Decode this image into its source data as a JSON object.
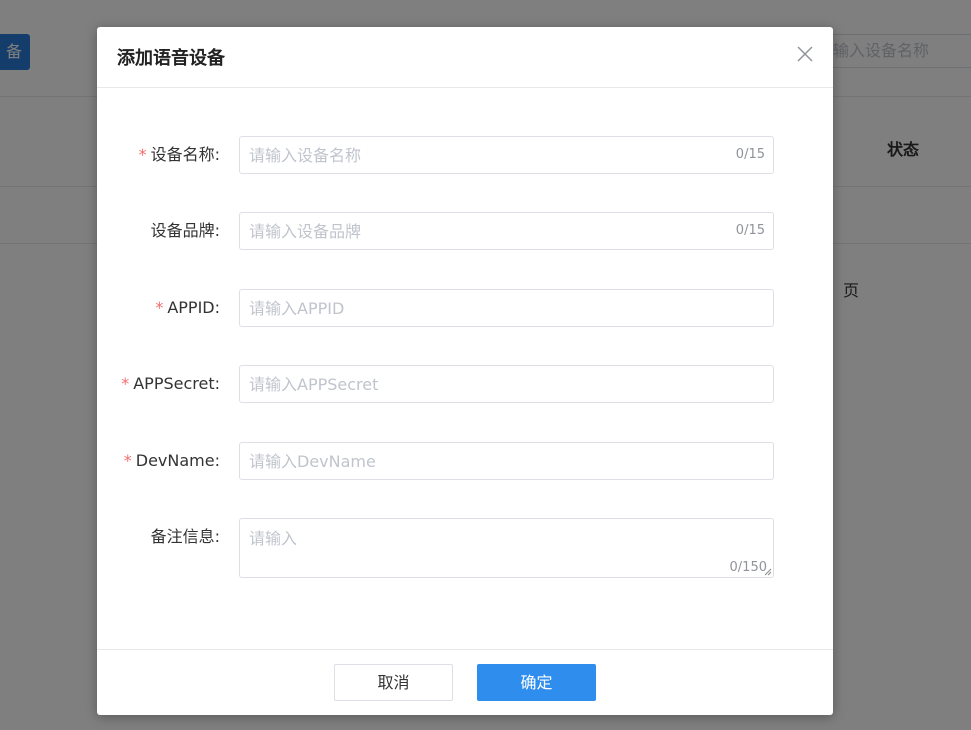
{
  "background": {
    "add_button_partial": "备",
    "search_placeholder_partial": "输入设备名称",
    "table_header_status": "状态",
    "pager_suffix": "页"
  },
  "dialog": {
    "title": "添加语音设备",
    "close_icon": "close-icon",
    "fields": [
      {
        "label": "设备名称:",
        "required": true,
        "placeholder": "请输入设备名称",
        "value": "",
        "counter": "0/15"
      },
      {
        "label": "设备品牌:",
        "required": false,
        "placeholder": "请输入设备品牌",
        "value": "",
        "counter": "0/15"
      },
      {
        "label": "APPID:",
        "required": true,
        "placeholder": "请输入APPID",
        "value": ""
      },
      {
        "label": "APPSecret:",
        "required": true,
        "placeholder": "请输入APPSecret",
        "value": ""
      },
      {
        "label": "DevName:",
        "required": true,
        "placeholder": "请输入DevName",
        "value": ""
      },
      {
        "label": "备注信息:",
        "required": false,
        "placeholder": "请输入",
        "value": "",
        "counter": "0/150"
      }
    ],
    "required_mark": "*",
    "cancel_label": "取消",
    "confirm_label": "确定"
  },
  "colors": {
    "primary": "#2e8ded",
    "required": "#f56c6c",
    "mask": "rgba(0,0,0,0.5)"
  }
}
